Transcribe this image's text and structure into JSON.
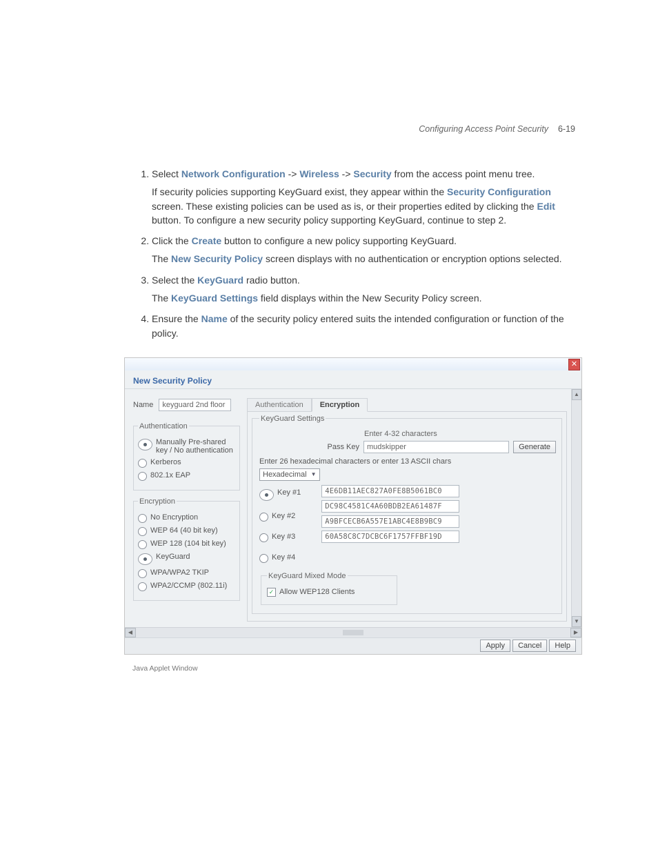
{
  "header": {
    "section": "Configuring Access Point Security",
    "page": "6-19"
  },
  "steps": {
    "s1": {
      "pre": "Select ",
      "kw1": "Network Configuration",
      "arr": " -> ",
      "kw2": "Wireless",
      "kw3": "Security",
      "post": " from the access point menu tree.",
      "p2a": "If security policies supporting KeyGuard exist, they appear within the ",
      "kw4": "Security Configuration",
      "p2b": " screen. These existing policies can be used as is, or their properties edited by clicking the ",
      "kw5": "Edit",
      "p2c": " button. To configure a new security policy supporting KeyGuard, continue to step 2."
    },
    "s2": {
      "pre": "Click the ",
      "kw1": "Create",
      "post": " button to configure a new policy supporting KeyGuard.",
      "p2a": "The ",
      "kw2": "New Security Policy",
      "p2b": " screen displays with no authentication or encryption options selected."
    },
    "s3": {
      "pre": "Select the ",
      "kw1": "KeyGuard",
      "post": " radio button.",
      "p2a": "The ",
      "kw2": "KeyGuard Settings",
      "p2b": " field displays within the New Security Policy screen."
    },
    "s4": {
      "pre": "Ensure the ",
      "kw1": "Name",
      "post": " of the security policy entered suits the intended configuration or function of the policy."
    }
  },
  "dialog": {
    "title": "New Security Policy",
    "name_label": "Name",
    "name_value": "keyguard 2nd floor",
    "auth_legend": "Authentication",
    "auth_options": {
      "mpk": "Manually Pre-shared key / No authentication",
      "kerb": "Kerberos",
      "eap": "802.1x EAP"
    },
    "enc_legend": "Encryption",
    "enc_options": {
      "none": "No Encryption",
      "wep64": "WEP 64 (40 bit key)",
      "wep128": "WEP 128 (104 bit key)",
      "keyguard": "KeyGuard",
      "tkip": "WPA/WPA2 TKIP",
      "ccmp": "WPA2/CCMP (802.11i)"
    },
    "tabs": {
      "auth": "Authentication",
      "enc": "Encryption"
    },
    "kg": {
      "legend": "KeyGuard Settings",
      "enter_hint": "Enter 4-32 characters",
      "passkey_label": "Pass Key",
      "passkey_value": "mudskipper",
      "generate": "Generate",
      "hex_hint": "Enter 26 hexadecimal characters or enter 13 ASCII chars",
      "format_sel": "Hexadecimal",
      "keys": {
        "k1_label": "Key #1",
        "k1_val": "4E6DB11AEC827A0FE8B5061BC0",
        "k2_label": "Key #2",
        "k2_val": "DC98C4581C4A60BDB2EA61487F",
        "k3_label": "Key #3",
        "k3_val": "A9BFCECB6A557E1ABC4E8B9BC9",
        "k4_label": "Key #4",
        "k4_val": "60A58C8C7DCBC6F1757FFBF19D"
      },
      "mix_legend": "KeyGuard Mixed Mode",
      "mix_chk": "Allow WEP128 Clients"
    },
    "buttons": {
      "apply": "Apply",
      "cancel": "Cancel",
      "help": "Help"
    },
    "footer": "Java Applet Window"
  }
}
